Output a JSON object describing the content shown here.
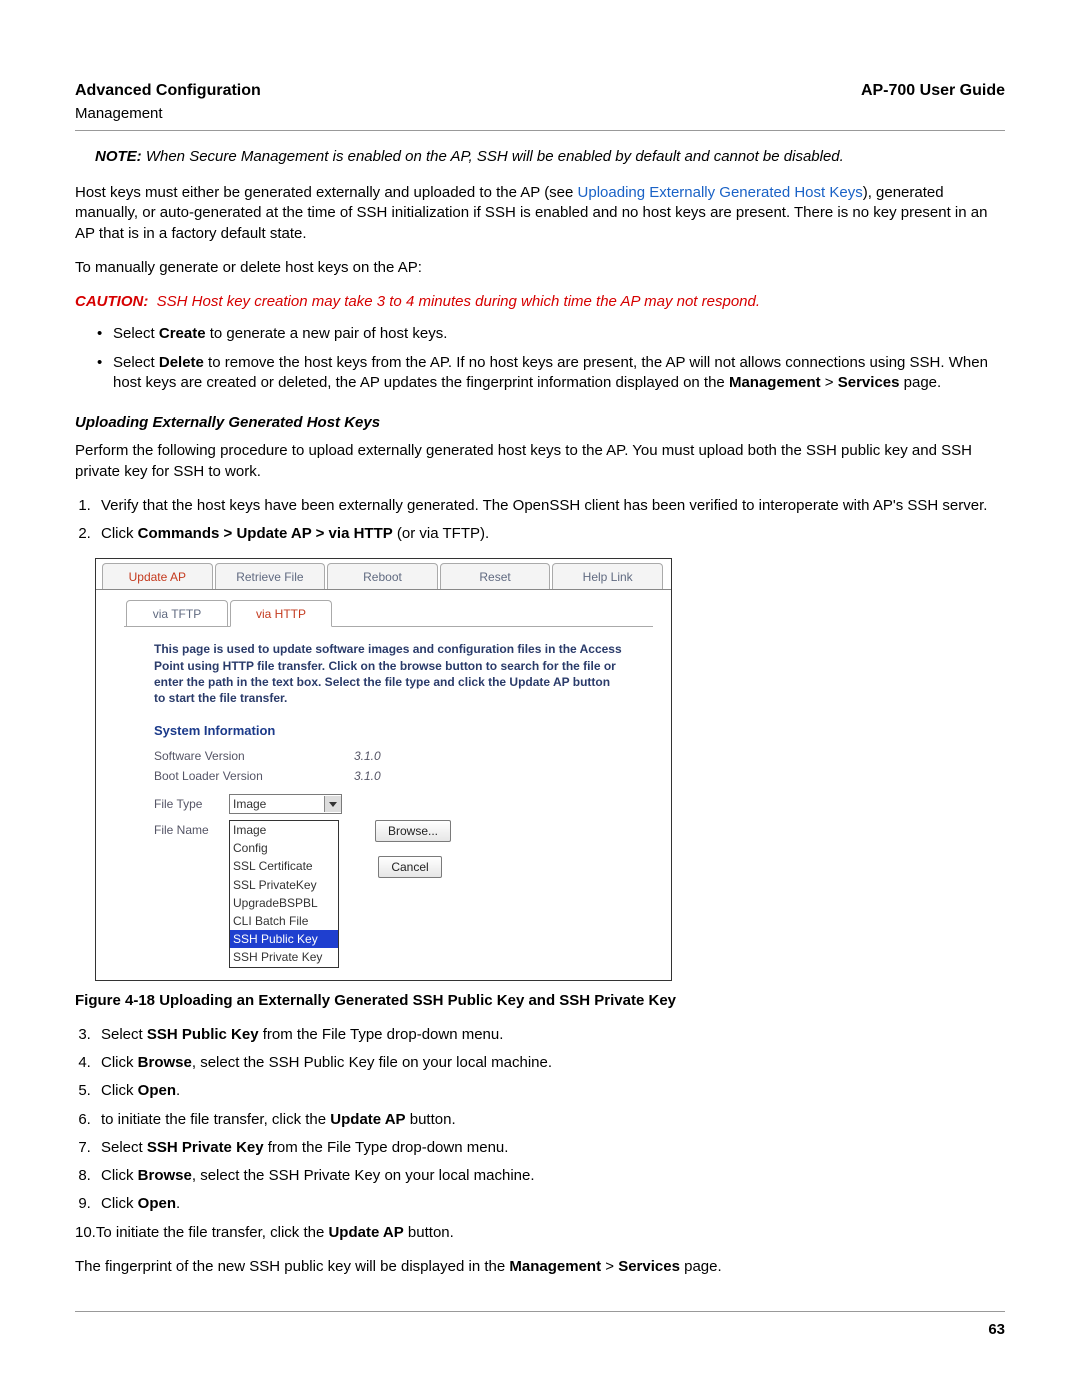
{
  "header": {
    "left_title": "Advanced Configuration",
    "left_sub": "Management",
    "right_title": "AP-700 User Guide"
  },
  "note": {
    "label": "NOTE:",
    "text": "When Secure Management is enabled on the AP, SSH will be enabled by default and cannot be disabled."
  },
  "para1_pre": "Host keys must either be generated externally and uploaded to the AP (see ",
  "para1_link": "Uploading Externally Generated Host Keys",
  "para1_post": "), generated manually, or auto-generated at the time of SSH initialization if SSH is enabled and no host keys are present. There is no key present in an AP that is in a factory default state.",
  "para2": "To manually generate or delete host keys on the AP:",
  "caution": {
    "label": "CAUTION:",
    "text": "SSH Host key creation may take 3 to 4 minutes during which time the AP may not respond."
  },
  "bullets": {
    "b1_pre": "Select ",
    "b1_bold": "Create",
    "b1_post": " to generate a new pair of host keys.",
    "b2_pre": "Select ",
    "b2_bold1": "Delete",
    "b2_mid": " to remove the host keys from the AP. If no host keys are present, the AP will not allows connections using SSH. When host keys are created or deleted, the AP updates the fingerprint information displayed on the ",
    "b2_bold2": "Management",
    "b2_gt": " > ",
    "b2_bold3": "Services",
    "b2_post": " page."
  },
  "sub_heading": "Uploading Externally Generated Host Keys",
  "para3": "Perform the following procedure to upload externally generated host keys to the AP. You must upload both the SSH public key and SSH private key for SSH to work.",
  "steps_a": {
    "s1": "Verify that the host keys have been externally generated. The OpenSSH client has been verified to interoperate with AP's SSH server.",
    "s2_pre": "Click ",
    "s2_bold": "Commands > Update AP > via HTTP",
    "s2_post": " (or via TFTP)."
  },
  "screenshot": {
    "top_tabs": [
      "Update AP",
      "Retrieve File",
      "Reboot",
      "Reset",
      "Help Link"
    ],
    "inner_tabs": [
      "via TFTP",
      "via HTTP"
    ],
    "help_text": "This page is used to update software images and configuration files in the Access Point using HTTP file transfer. Click on the browse button to search for the file or enter the path in the text box. Select the file type and click the Update AP button to start the file transfer.",
    "sysinfo_title": "System Information",
    "sw_label": "Software Version",
    "sw_value": "3.1.0",
    "bl_label": "Boot Loader Version",
    "bl_value": "3.1.0",
    "filetype_label": "File Type",
    "filetype_selected": "Image",
    "filename_label": "File Name",
    "browse_btn": "Browse...",
    "cancel_btn": "Cancel",
    "options": [
      "Image",
      "Config",
      "SSL Certificate",
      "SSL PrivateKey",
      "UpgradeBSPBL",
      "CLI Batch File",
      "SSH Public Key",
      "SSH Private Key"
    ]
  },
  "figure_caption": "Figure 4-18 Uploading an Externally Generated SSH Public Key and SSH Private Key",
  "steps_b": {
    "s3_pre": "Select ",
    "s3_bold": "SSH Public Key",
    "s3_post": " from the File Type drop-down menu.",
    "s4_pre": "Click ",
    "s4_bold": "Browse",
    "s4_post": ", select the SSH Public Key file on your local machine.",
    "s5_pre": "Click ",
    "s5_bold": "Open",
    "s5_post": ".",
    "s6_pre": "to initiate the file transfer, click the ",
    "s6_bold": "Update AP",
    "s6_post": " button.",
    "s7_pre": "Select ",
    "s7_bold": "SSH Private Key",
    "s7_post": " from the File Type drop-down menu.",
    "s8_pre": "Click ",
    "s8_bold": "Browse",
    "s8_post": ", select the SSH Private Key on your local machine.",
    "s9_pre": "Click ",
    "s9_bold": "Open",
    "s9_post": ".",
    "s10_pre": "10.To initiate the file transfer, click the ",
    "s10_bold": "Update AP",
    "s10_post": " button."
  },
  "para4_pre": "The fingerprint of the new SSH public key will be displayed in the ",
  "para4_bold1": "Management",
  "para4_gt": " > ",
  "para4_bold2": "Services",
  "para4_post": " page.",
  "page_number": "63"
}
